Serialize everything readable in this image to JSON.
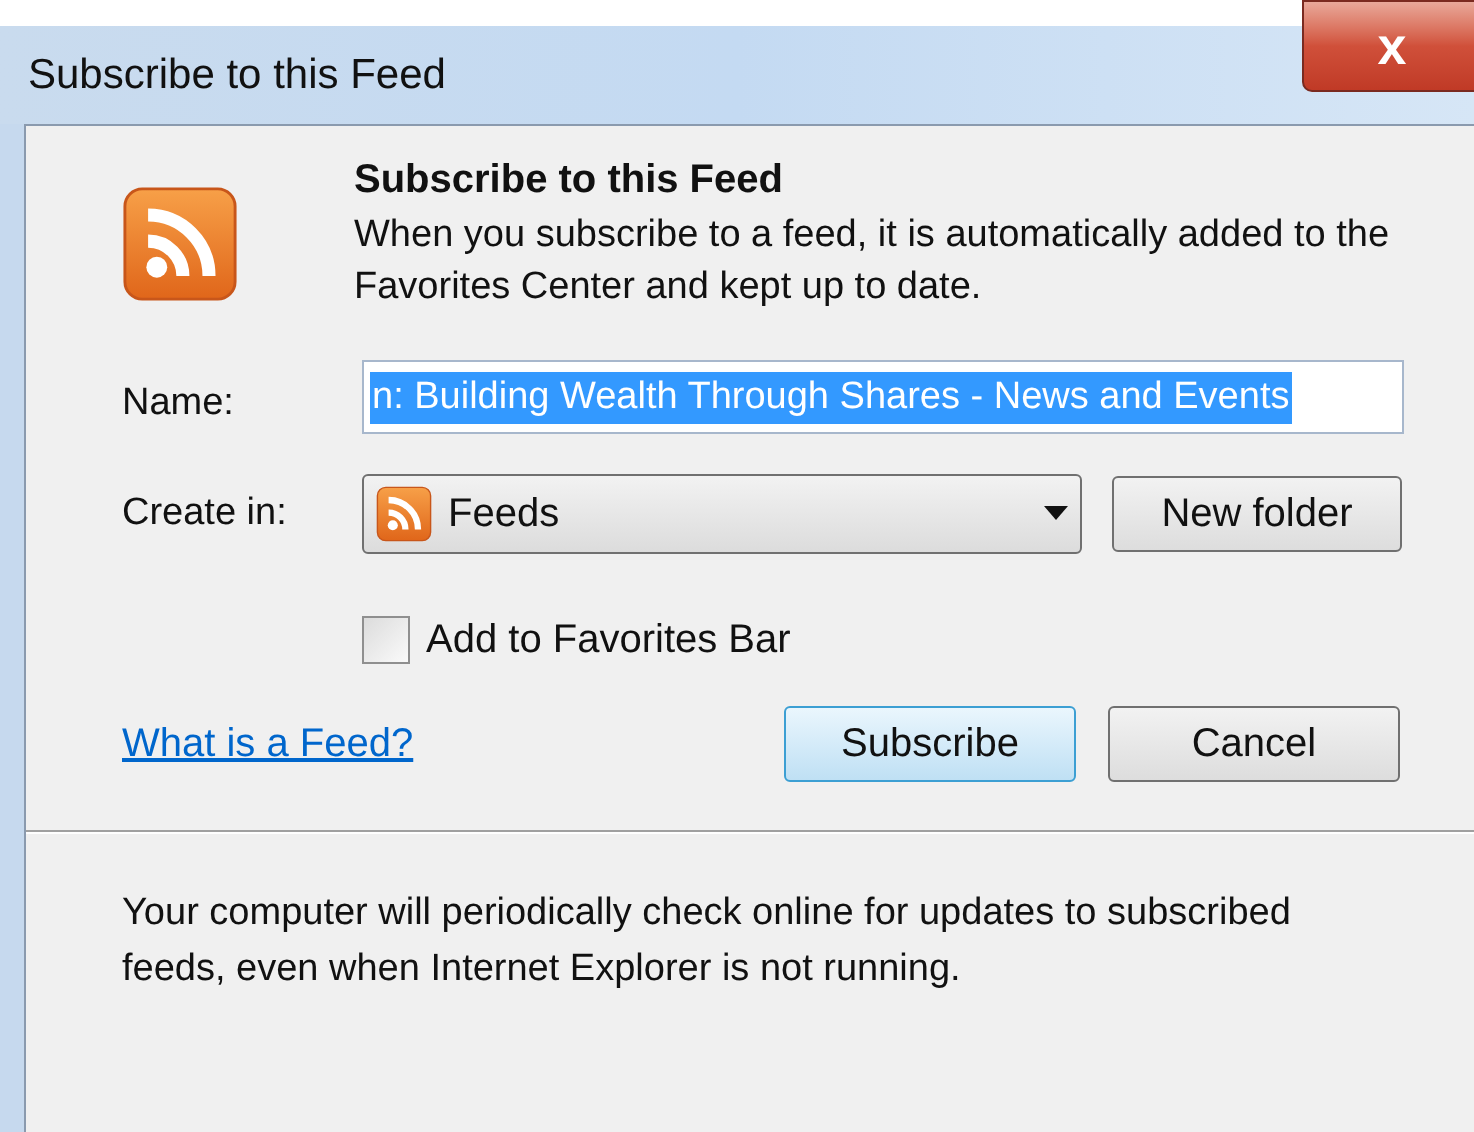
{
  "window": {
    "title": "Subscribe to this Feed",
    "close": "x"
  },
  "header": {
    "title": "Subscribe to this Feed",
    "description": "When you subscribe to a feed, it is automatically added to the Favorites Center and kept up to date."
  },
  "name_field": {
    "label": "Name:",
    "value": "n: Building Wealth Through Shares - News and Events",
    "selected": true
  },
  "create_in": {
    "label": "Create in:",
    "value": "Feeds",
    "new_folder": "New folder"
  },
  "favorites_bar": {
    "label": "Add to Favorites Bar",
    "checked": false
  },
  "help_link": "What is a Feed?",
  "buttons": [
    {
      "label": "Subscribe",
      "selected": true
    },
    {
      "label": "Cancel",
      "selected": false
    }
  ],
  "footer": "Your computer will periodically check online for updates to subscribed feeds, even when Internet Explorer is not running."
}
